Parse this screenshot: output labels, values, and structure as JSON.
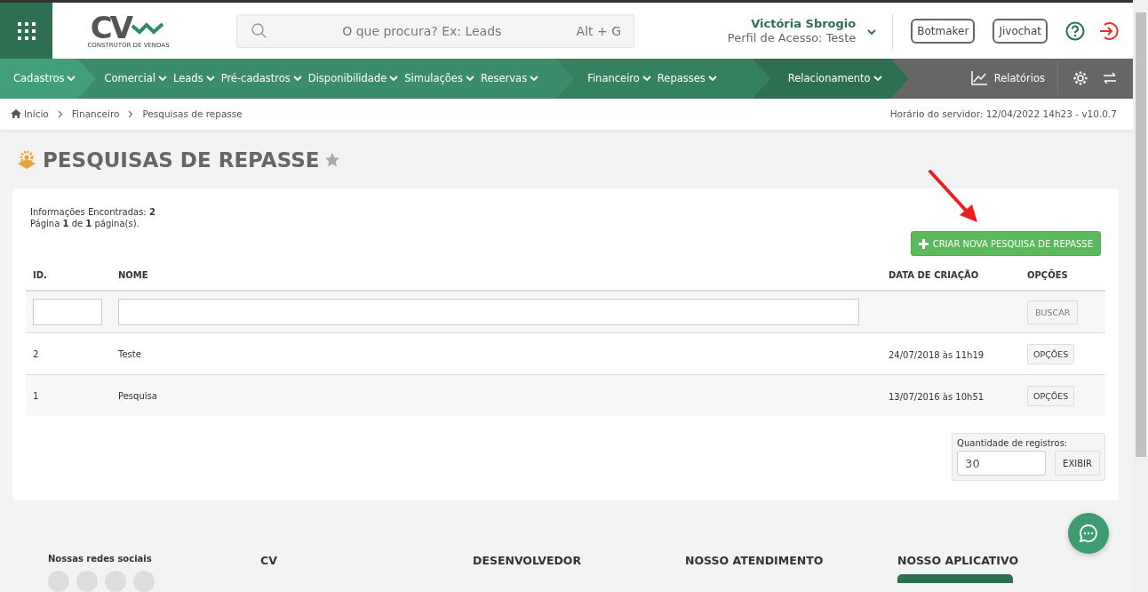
{
  "header": {
    "logo_mark": "CV",
    "logo_tagline": "CONSTRUTOR DE VENDAS",
    "search": {
      "placeholder": "O que procura? Ex: Leads",
      "shortcut": "Alt + G"
    },
    "user": {
      "name": "Victória Sbrogio",
      "profile": "Perfil de Acesso: Teste"
    },
    "buttons": [
      "Botmaker",
      "Jivochat"
    ]
  },
  "nav": {
    "groups": [
      {
        "items": [
          "Cadastros"
        ]
      },
      {
        "items": [
          "Comercial",
          "Leads",
          "Pré-cadastros",
          "Disponibilidade",
          "Simulações",
          "Reservas"
        ]
      },
      {
        "items": [
          "Financeiro",
          "Repasses"
        ]
      },
      {
        "items": [
          "Relacionamento"
        ]
      }
    ],
    "reports": "Relatórios"
  },
  "breadcrumb": {
    "items": [
      "Início",
      "Financeiro",
      "Pesquisas de repasse"
    ],
    "server_time": "Horário do servidor: 12/04/2022 14h23 - v10.0.7"
  },
  "page_title": "PESQUISAS DE REPASSE",
  "summary": [
    "Informações Encontradas: **2**",
    "Página **1** de **1** página(s)."
  ],
  "create_button": "CRIAR NOVA PESQUISA DE REPASSE",
  "table": {
    "columns": [
      "ID.",
      "NOME",
      "DATA DE CRIAÇÃO",
      "OPÇÕES"
    ],
    "filter_button": "BUSCAR",
    "rows": [
      {
        "id": "2",
        "name": "Teste",
        "created": "24/07/2018 às 11h19",
        "action": "OPÇÕES"
      },
      {
        "id": "1",
        "name": "Pesquisa",
        "created": "13/07/2016 às 10h51",
        "action": "OPÇÕES"
      }
    ]
  },
  "page_size": {
    "label": "Quantidade de registros:",
    "value": "30",
    "button": "EXIBIR"
  },
  "footer": {
    "headings": [
      "Nossas redes sociais",
      "CV",
      "DESENVOLVEDOR",
      "NOSSO ATENDIMENTO",
      "NOSSO APLICATIVO"
    ]
  }
}
